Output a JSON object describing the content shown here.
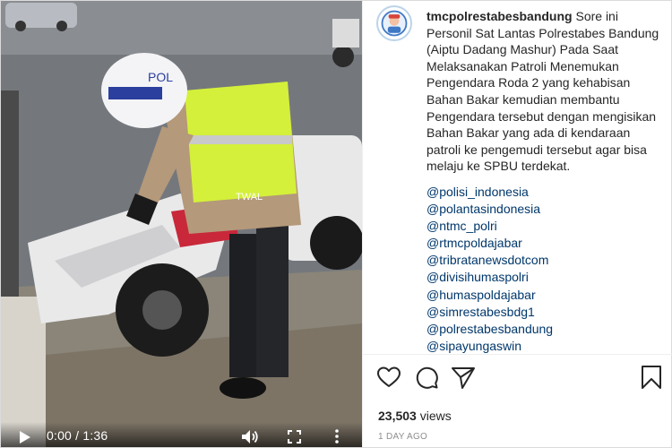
{
  "video": {
    "time": "0:00 / 1:36",
    "scene_labels": {
      "helmet_text": "POL",
      "vest_text": "TWAL"
    }
  },
  "post": {
    "username": "tmcpolrestabesbandung",
    "caption": "Sore ini Personil Sat Lantas Polrestabes Bandung (Aiptu Dadang Mashur) Pada Saat Melaksanakan Patroli Menemukan Pengendara Roda 2 yang kehabisan Bahan Bakar kemudian membantu Pengendara tersebut dengan mengisikan Bahan Bakar yang ada di kendaraan patroli ke pengemudi tersebut agar bisa melaju ke SPBU terdekat.",
    "caption_lines": [
      "Sore ini",
      "Personil Sat Lantas Polrestabes Bandung",
      "(Aiptu Dadang Mashur) Pada Saat",
      "Melaksanakan Patroli Menemukan",
      "Pengendara Roda 2 yang kehabisan",
      "Bahan Bakar kemudian membantu",
      "Pengendara tersebut dengan mengisikan",
      "Bahan Bakar yang ada di kendaraan",
      "patroli ke pengemudi tersebut agar bisa",
      "melaju ke SPBU terdekat."
    ],
    "mentions": [
      "@polisi_indonesia",
      "@polantasindonesia",
      "@ntmc_polri",
      "@rtmcpoldajabar",
      "@tribratanewsdotcom",
      "@divisihumaspolri",
      "@humaspoldajabar",
      "@simrestabesbdg1",
      "@polrestabesbandung",
      "@sipayungaswin"
    ],
    "views_count": "23,503",
    "views_label": "views",
    "posted": "1 DAY AGO"
  },
  "icons": {
    "play": "play-icon",
    "volume": "volume-icon",
    "fullscreen": "fullscreen-icon",
    "more": "more-vertical-icon",
    "like": "heart-icon",
    "comment": "comment-icon",
    "share": "share-icon",
    "save": "bookmark-icon"
  },
  "colors": {
    "mention": "#00376b",
    "text": "#262626",
    "muted": "#8e8e8e",
    "vest": "#d4f03a"
  }
}
